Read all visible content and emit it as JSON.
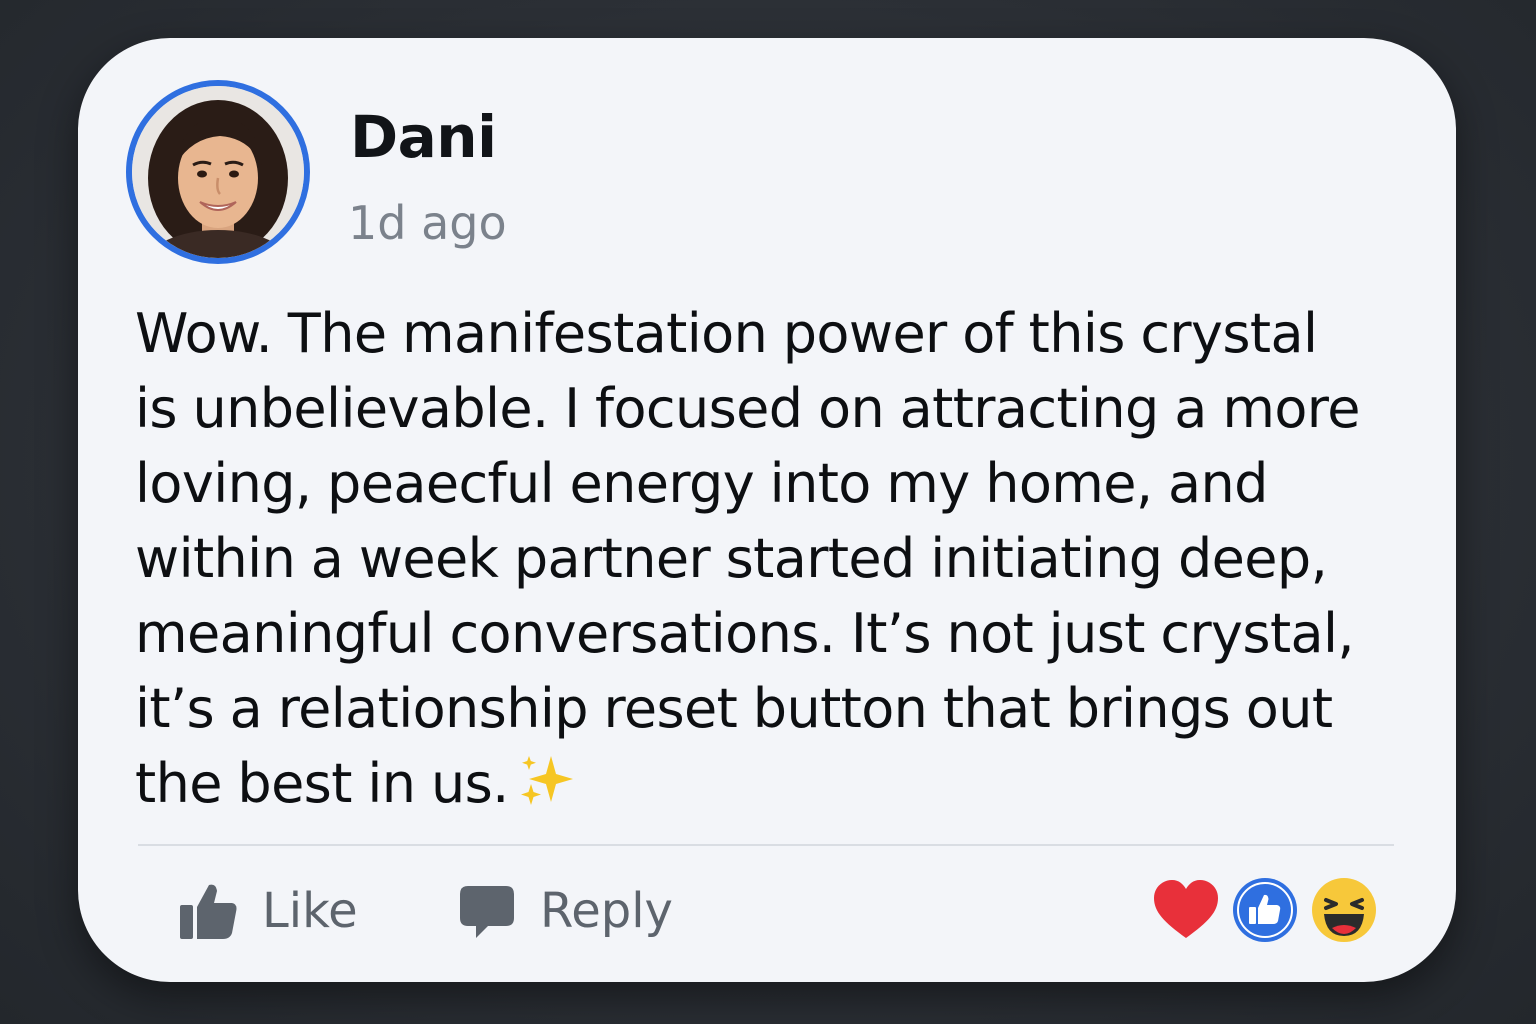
{
  "post": {
    "author": "Dani",
    "timestamp": "1d ago",
    "body_lines": [
      "Wow. The manifestation power of this crystal",
      "is unbelievable. I focused on attracting a more",
      "loving, peaecful energy into my home, and",
      "within a week partner started initiating deep,",
      "meaningful conversations. It’s not just crystal,",
      "it’s a relationship reset button that brings out",
      "the best in us."
    ],
    "body_emoji": "sparkles-icon"
  },
  "actions": {
    "like_label": "Like",
    "reply_label": "Reply"
  },
  "reactions": [
    "heart-reaction-icon",
    "thumbs-up-reaction-icon",
    "laughing-reaction-icon"
  ],
  "colors": {
    "accent": "#2f6fe0",
    "card_background": "#f3f5f9",
    "page_background": "#2b2f35",
    "heart": "#e8303a",
    "laugh": "#f7c83a",
    "muted_text": "#5d646d"
  }
}
